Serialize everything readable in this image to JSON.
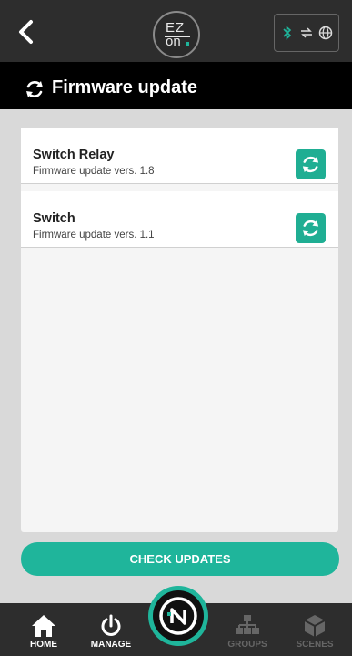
{
  "header": {
    "logo_line1": "EZ",
    "logo_line2": "on"
  },
  "title": "Firmware update",
  "devices": [
    {
      "name": "Switch Relay",
      "firmware": "Firmware update vers. 1.8"
    },
    {
      "name": "Switch",
      "firmware": "Firmware update vers. 1.1"
    }
  ],
  "actions": {
    "check_updates": "CHECK UPDATES"
  },
  "nav": [
    {
      "label": "HOME",
      "icon": "home-icon",
      "active": true
    },
    {
      "label": "MANAGE",
      "icon": "power-icon",
      "active": true
    },
    {
      "label": "GROUPS",
      "icon": "groups-icon",
      "active": false
    },
    {
      "label": "SCENES",
      "icon": "cube-icon",
      "active": false
    }
  ],
  "colors": {
    "accent": "#1fb59b",
    "topbar": "#2d2d2d",
    "titlebar": "#000000",
    "background": "#d9d9d9"
  }
}
